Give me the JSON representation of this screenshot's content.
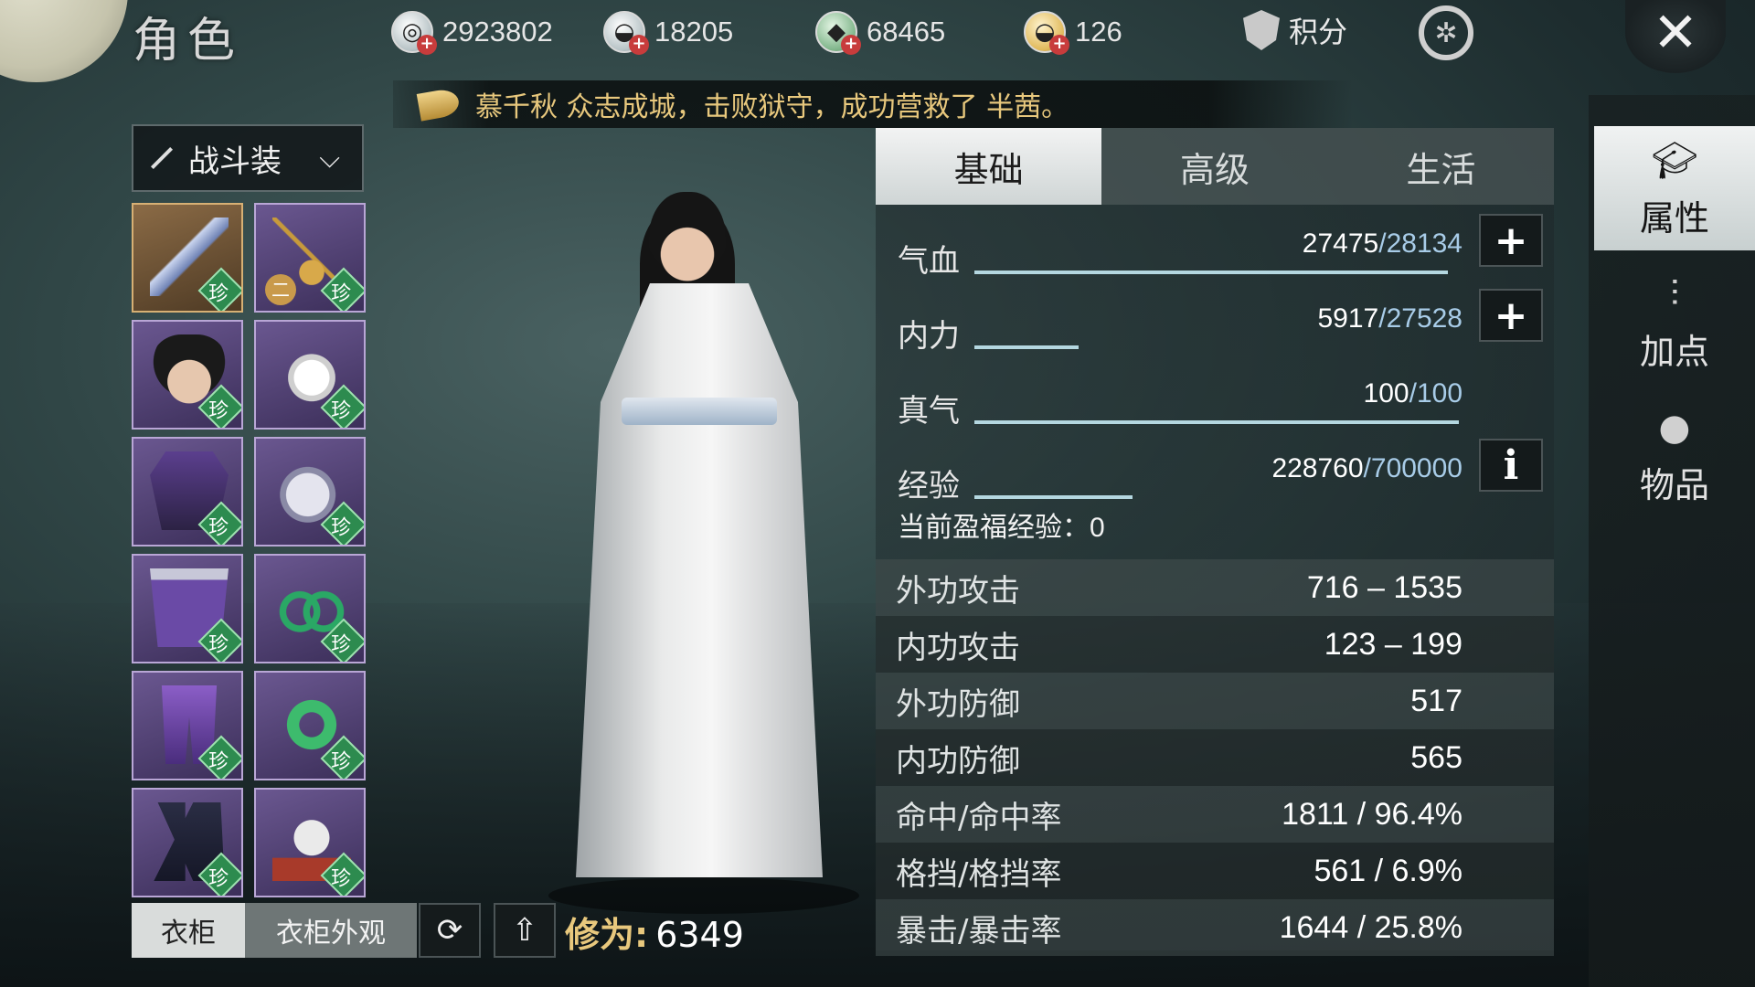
{
  "header": {
    "title": "角色",
    "currencies": [
      {
        "icon": "coin-icon",
        "value": "2923802"
      },
      {
        "icon": "silver-ingot-icon",
        "value": "18205"
      },
      {
        "icon": "jade-ticket-icon",
        "value": "68465"
      },
      {
        "icon": "gold-ingot-icon",
        "value": "126"
      }
    ],
    "points_label": "积分",
    "close_glyph": "✕"
  },
  "notice": {
    "text": "慕千秋 众志成城，击败狱守，成功营救了 半茜。"
  },
  "loadout": {
    "selected": "战斗装"
  },
  "equipment": [
    {
      "name": "weapon",
      "icon": "blade-icon",
      "badge": "珍",
      "tag": ""
    },
    {
      "name": "pendant",
      "icon": "pendant-icon",
      "badge": "珍",
      "tag": "二"
    },
    {
      "name": "head",
      "icon": "hair-icon",
      "badge": "珍",
      "tag": ""
    },
    {
      "name": "accessory",
      "icon": "lotus-icon",
      "badge": "珍",
      "tag": ""
    },
    {
      "name": "chest",
      "icon": "robe-icon",
      "badge": "珍",
      "tag": ""
    },
    {
      "name": "gloves",
      "icon": "gauntlet-icon",
      "badge": "珍",
      "tag": ""
    },
    {
      "name": "belt",
      "icon": "belt-icon",
      "badge": "珍",
      "tag": ""
    },
    {
      "name": "bracelet",
      "icon": "bangles-icon",
      "badge": "珍",
      "tag": ""
    },
    {
      "name": "legs",
      "icon": "pants-icon",
      "badge": "珍",
      "tag": ""
    },
    {
      "name": "ring",
      "icon": "jade-ring-icon",
      "badge": "珍",
      "tag": ""
    },
    {
      "name": "boots",
      "icon": "boots-icon",
      "badge": "珍",
      "tag": ""
    },
    {
      "name": "charm",
      "icon": "charm-icon",
      "badge": "珍",
      "tag": ""
    }
  ],
  "bottom": {
    "wardrobe_label": "衣柜",
    "wardrobe_appearance_label": "衣柜外观",
    "cultivation_label": "修为:",
    "cultivation_value": "6349"
  },
  "tabs": [
    {
      "label": "基础",
      "active": true
    },
    {
      "label": "高级",
      "active": false
    },
    {
      "label": "生活",
      "active": false
    }
  ],
  "bars": [
    {
      "label": "气血",
      "current": "27475",
      "max": "/28134",
      "fraction": 0.977,
      "button": "+"
    },
    {
      "label": "内力",
      "current": "5917",
      "max": "/27528",
      "fraction": 0.215,
      "button": "+"
    },
    {
      "label": "真气",
      "current": "100",
      "max": "/100",
      "fraction": 1.0,
      "button": ""
    },
    {
      "label": "经验",
      "current": "228760",
      "max": "/700000",
      "fraction": 0.327,
      "button": "i"
    }
  ],
  "bonus_exp": {
    "label": "当前盈福经验：",
    "value": "0"
  },
  "attributes": [
    {
      "name": "外功攻击",
      "value": "716 – 1535"
    },
    {
      "name": "内功攻击",
      "value": "123 – 199"
    },
    {
      "name": "外功防御",
      "value": "517"
    },
    {
      "name": "内功防御",
      "value": "565"
    },
    {
      "name": "命中/命中率",
      "value": "1811 / 96.4%"
    },
    {
      "name": "格挡/格挡率",
      "value": "561 / 6.9%"
    },
    {
      "name": "暴击/暴击率",
      "value": "1644 / 25.8%"
    }
  ],
  "rightnav": [
    {
      "label": "属性",
      "icon": "scholar-hat-icon",
      "active": true
    },
    {
      "label": "加点",
      "icon": "sliders-icon",
      "active": false
    },
    {
      "label": "物品",
      "icon": "pouch-icon",
      "active": false
    }
  ],
  "colors": {
    "accent_gold": "#e8c87d",
    "max_value_blue": "#a8cce8",
    "rarity_badge": "#2d8b4f"
  }
}
